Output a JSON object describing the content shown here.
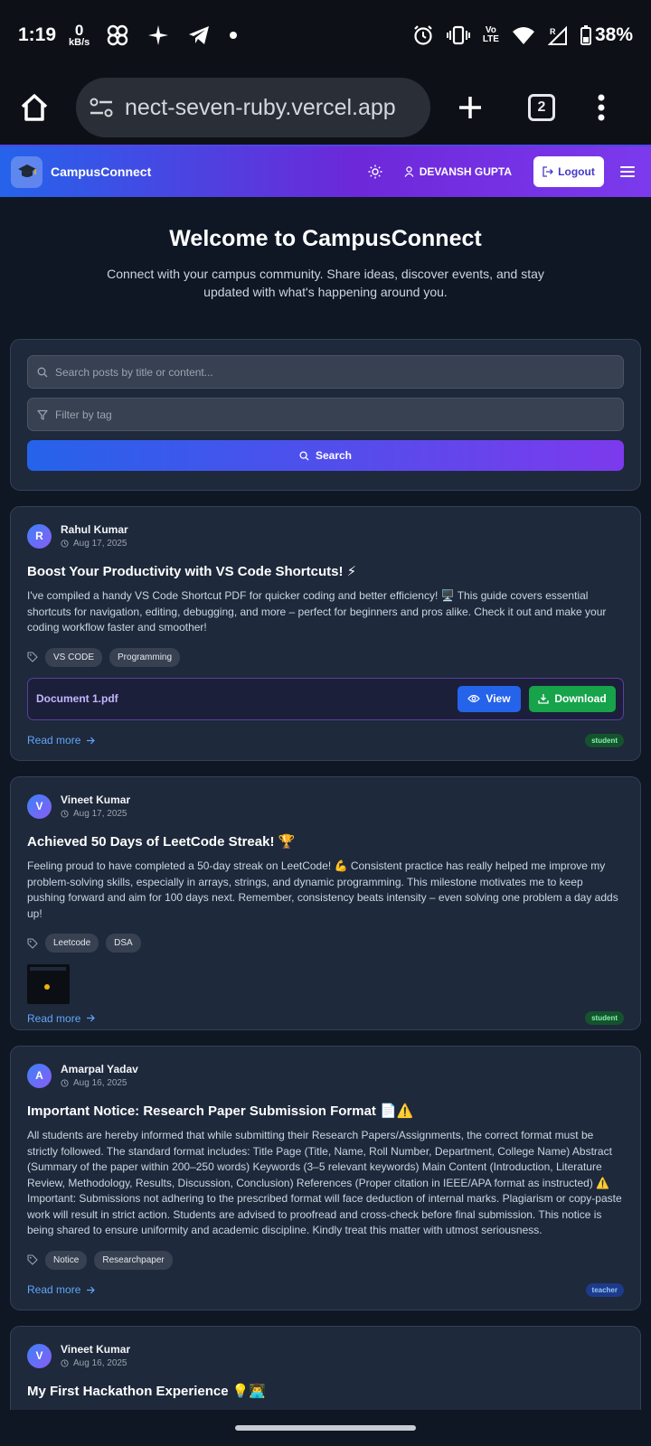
{
  "status_bar": {
    "time": "1:19",
    "net_speed_value": "0",
    "net_speed_unit": "kB/s",
    "volte_top": "Vo",
    "volte_bottom": "LTE",
    "battery": "38%"
  },
  "browser": {
    "url": "nect-seven-ruby.vercel.app",
    "tab_count": "2"
  },
  "navbar": {
    "brand": "CampusConnect",
    "user_name": "DEVANSH GUPTA",
    "logout_label": "Logout"
  },
  "hero": {
    "title": "Welcome to CampusConnect",
    "subtitle": "Connect with your campus community. Share ideas, discover events, and stay updated with what's happening around you."
  },
  "search": {
    "search_placeholder": "Search posts by title or content...",
    "tag_placeholder": "Filter by tag",
    "button_label": "Search"
  },
  "posts": [
    {
      "initial": "R",
      "author": "Rahul Kumar",
      "date": "Aug 17, 2025",
      "title": "Boost Your Productivity with VS Code Shortcuts! ⚡",
      "body": "I've compiled a handy VS Code Shortcut PDF for quicker coding and better efficiency! 🖥️ This guide covers essential shortcuts for navigation, editing, debugging, and more – perfect for beginners and pros alike. Check it out and make your coding workflow faster and smoother!",
      "tags": [
        "VS CODE",
        "Programming"
      ],
      "attachment": {
        "name": "Document 1.pdf",
        "view_label": "View",
        "download_label": "Download"
      },
      "read_more": "Read more",
      "role": "student"
    },
    {
      "initial": "V",
      "author": "Vineet Kumar",
      "date": "Aug 17, 2025",
      "title": "Achieved 50 Days of LeetCode Streak! 🏆",
      "body": "Feeling proud to have completed a 50-day streak on LeetCode! 💪 Consistent practice has really helped me improve my problem-solving skills, especially in arrays, strings, and dynamic programming. This milestone motivates me to keep pushing forward and aim for 100 days next. Remember, consistency beats intensity – even solving one problem a day adds up!",
      "tags": [
        "Leetcode",
        "DSA"
      ],
      "read_more": "Read more",
      "role": "student"
    },
    {
      "initial": "A",
      "author": "Amarpal Yadav",
      "date": "Aug 16, 2025",
      "title": "Important Notice: Research Paper Submission Format 📄⚠️",
      "body": "All students are hereby informed that while submitting their Research Papers/Assignments, the correct format must be strictly followed. The standard format includes: Title Page (Title, Name, Roll Number, Department, College Name) Abstract (Summary of the paper within 200–250 words) Keywords (3–5 relevant keywords) Main Content (Introduction, Literature Review, Methodology, Results, Discussion, Conclusion) References (Proper citation in IEEE/APA format as instructed) ⚠️ Important: Submissions not adhering to the prescribed format will face deduction of internal marks. Plagiarism or copy-paste work will result in strict action. Students are advised to proofread and cross-check before final submission. This notice is being shared to ensure uniformity and academic discipline. Kindly treat this matter with utmost seriousness.",
      "tags": [
        "Notice",
        "Researchpaper"
      ],
      "read_more": "Read more",
      "role": "teacher"
    },
    {
      "initial": "V",
      "author": "Vineet Kumar",
      "date": "Aug 16, 2025",
      "title": "My First Hackathon Experience 💡👨‍💻"
    }
  ],
  "colors": {
    "navbar_gradient_start": "#2563eb",
    "navbar_gradient_end": "#7c3aed",
    "page_bg": "#0f1725",
    "card_bg": "#1e293b",
    "view_button": "#2563eb",
    "download_button": "#16a34a"
  }
}
